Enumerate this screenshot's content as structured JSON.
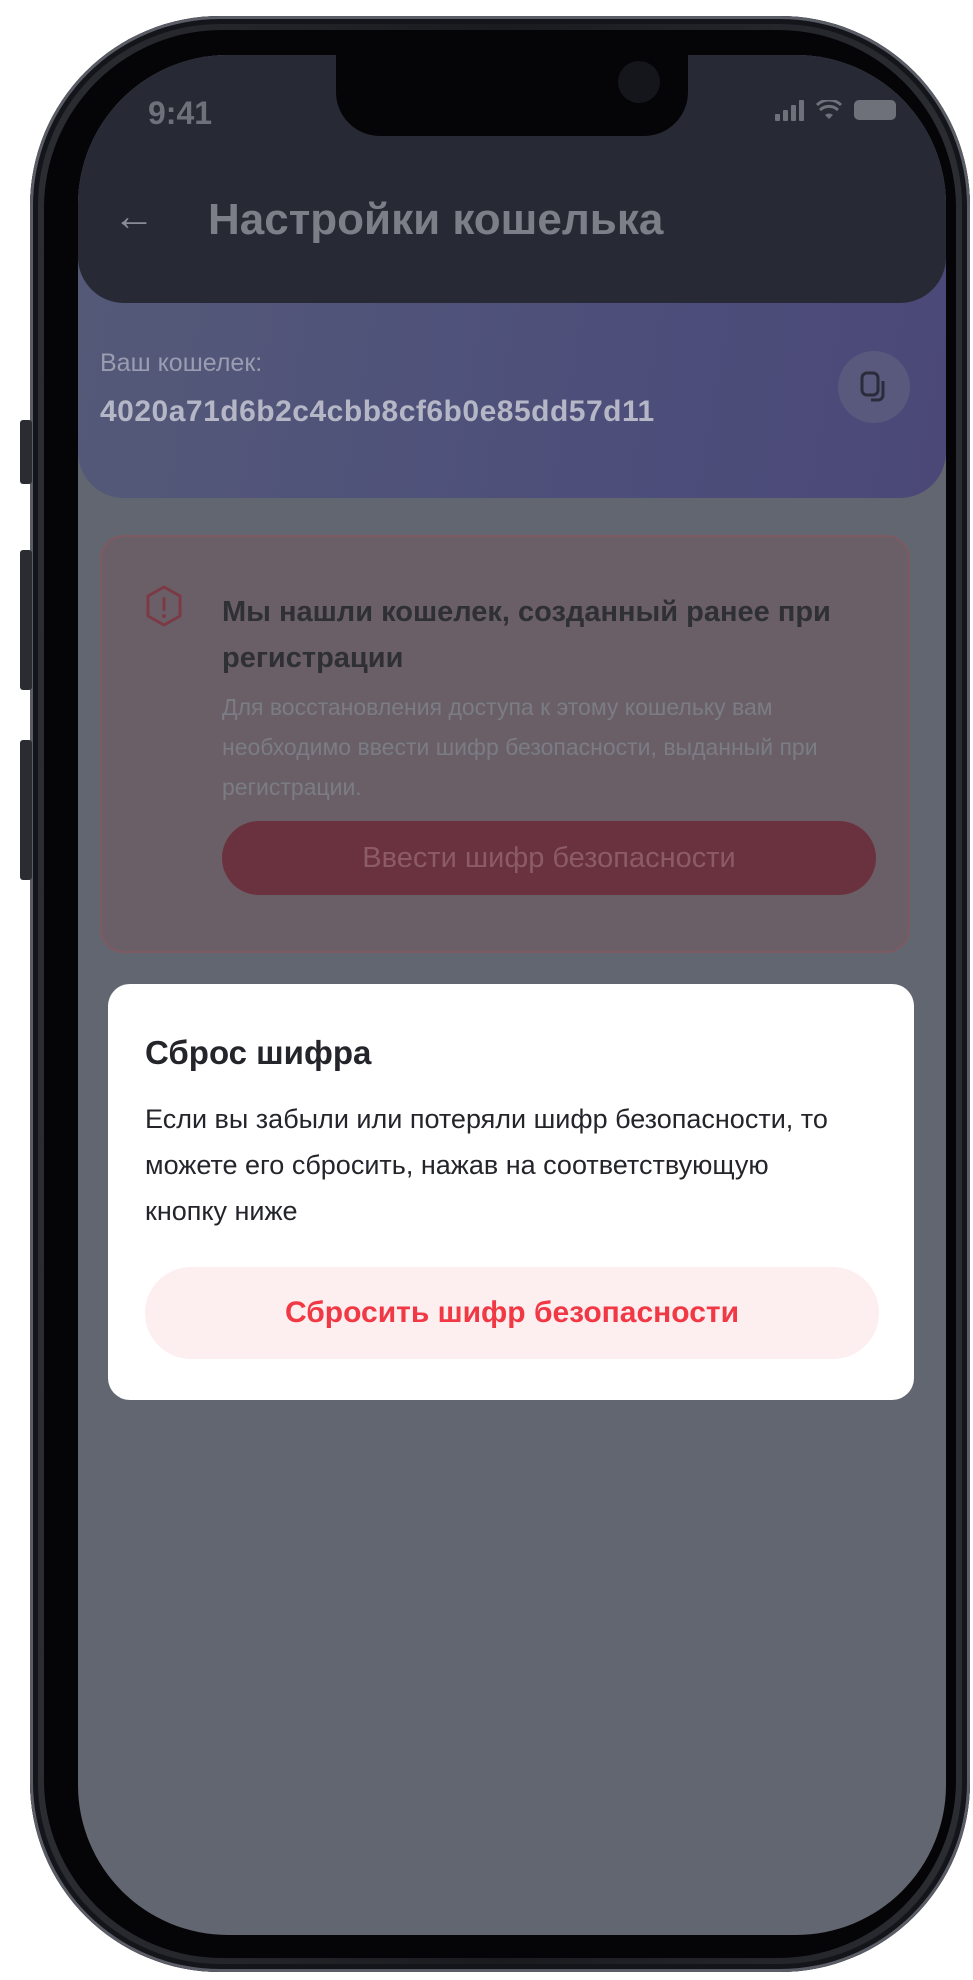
{
  "status_bar": {
    "time": "9:41"
  },
  "header": {
    "back_icon": "arrow-left-icon",
    "title": "Настройки кошелька"
  },
  "wallet": {
    "label": "Ваш кошелек:",
    "address": "4020a71d6b2c4cbb8cf6b0e85dd57d11",
    "copy_icon": "copy-icon"
  },
  "warning": {
    "icon": "alert-icon",
    "title": "Мы нашли кошелек, созданный ранее при регистрации",
    "description": "Для восстановления доступа к этому кошельку вам необходимо ввести шифр безопасности, выданный при регистрации.",
    "button_label": "Ввести шифр безопасности",
    "accent_color": "#f13845"
  },
  "modal": {
    "title": "Сброс шифра",
    "text": "Если вы забыли или потеряли шифр безопасности, то можете его сбросить, нажав на соответствующую кнопку ниже",
    "button_label": "Сбросить шифр безопасности",
    "button_color": "#f13845"
  }
}
